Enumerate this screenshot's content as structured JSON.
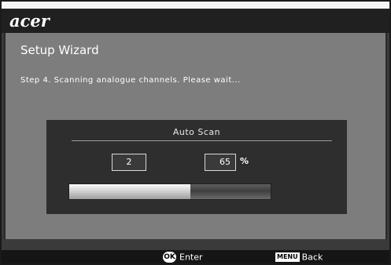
{
  "brand": {
    "logo_text": "acer"
  },
  "wizard": {
    "title": "Setup Wizard",
    "step_text": "Step 4. Scanning analogue channels. Please wait..."
  },
  "scan": {
    "title": "Auto Scan",
    "channels_found": "2",
    "percent_value": "65",
    "percent_unit": "%",
    "progress_fraction": 0.6
  },
  "footer": {
    "ok_icon_label": "OK",
    "enter_label": "Enter",
    "menu_icon_label": "MENU",
    "back_label": "Back"
  },
  "colors": {
    "panel_bg": "#2e2e2e",
    "content_bg": "#7d7d7d"
  }
}
